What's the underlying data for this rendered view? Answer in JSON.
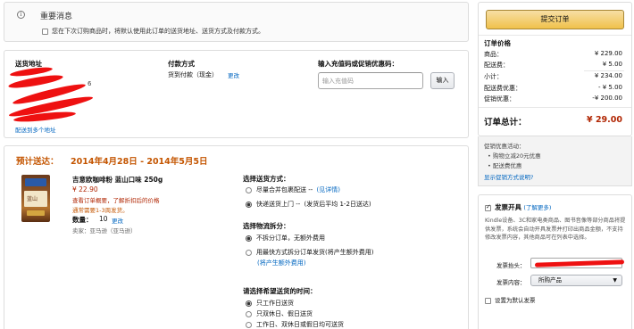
{
  "notice": {
    "title": "重要消息",
    "checkbox_label": "您在下次订购商品时，将默认使用此订单的送货地址、送货方式及付款方式。"
  },
  "address": {
    "heading": "送货地址",
    "fragment": "6",
    "ship_to_more": "配送到多个地址"
  },
  "payment": {
    "heading": "付款方式",
    "method": "货到付款（现金）",
    "change_link": "更改"
  },
  "coupon": {
    "heading": "输入充值码或促销优惠码：",
    "placeholder": "输入充值码",
    "button_label": "输入"
  },
  "delivery": {
    "estimate_label": "预计送达：",
    "estimate_range": "2014年4月28日 - 2014年5月5日"
  },
  "item": {
    "title": "吉意欧咖啡粉 蓝山口味 250g",
    "price": "¥ 22.90",
    "promo": "查看订单概要，了解折扣后的价格",
    "stock": "通常需要1-3周发货。",
    "qty_label": "数量：",
    "qty_value": "10",
    "qty_change": "更改",
    "seller": "卖家：亚马逊（亚马逊）",
    "image_label": "蓝山"
  },
  "shipping_method": {
    "heading": "选择送货方式：",
    "options": [
      {
        "label": "尽量合并包裹配送 --",
        "extra": "(见详情)",
        "selected": false
      },
      {
        "label": "快递送货上门 --",
        "extra": "(发货后平均 1-2日送达)",
        "selected": true
      }
    ]
  },
  "split": {
    "heading": "选择物流拆分：",
    "options": [
      {
        "label": "不拆分订单，无额外费用",
        "selected": true
      },
      {
        "label": "用最快方式拆分订单发货(将产生额外费用)",
        "extra": "(将产生额外费用)",
        "selected": false
      }
    ]
  },
  "delivery_time": {
    "heading": "请选择希望送货的时间：",
    "options": [
      {
        "label": "只工作日送货",
        "selected": true
      },
      {
        "label": "只双休日、假日送货",
        "selected": false
      },
      {
        "label": "工作日、双休日或假日均可送货",
        "selected": false
      }
    ]
  },
  "summary": {
    "submit_label": "提交订单",
    "heading": "订单价格",
    "lines": [
      {
        "label": "商品：",
        "value": "¥ 229.00"
      },
      {
        "label": "配送费：",
        "value": "¥ 5.00"
      },
      {
        "label": "小计：",
        "value": "¥ 234.00"
      },
      {
        "label": "配送费优惠：",
        "value": "- ¥ 5.00"
      },
      {
        "label": "促销优惠：",
        "value": "-¥ 200.00"
      }
    ],
    "total_label": "订单总计：",
    "total_value": "¥ 29.00"
  },
  "promotions": {
    "heading": "促销优惠活动：",
    "items": [
      "购物立减20元优惠",
      "配送费优惠"
    ],
    "link": "显示促销方式说明?"
  },
  "invoice": {
    "checkbox_label": "发票开具",
    "learn_more": "(了解更多)",
    "description": "Kindle设备、3C和家电类商品、图书音像等部分商品将提供发票，系统会自动开具发票并打印出商品金额，不支持修改发票内容，其他商品可在列表中选择。",
    "header_label": "发票抬头：",
    "content_label": "发票内容：",
    "content_value": "所购产品",
    "default_label": "设置为默认发票"
  }
}
